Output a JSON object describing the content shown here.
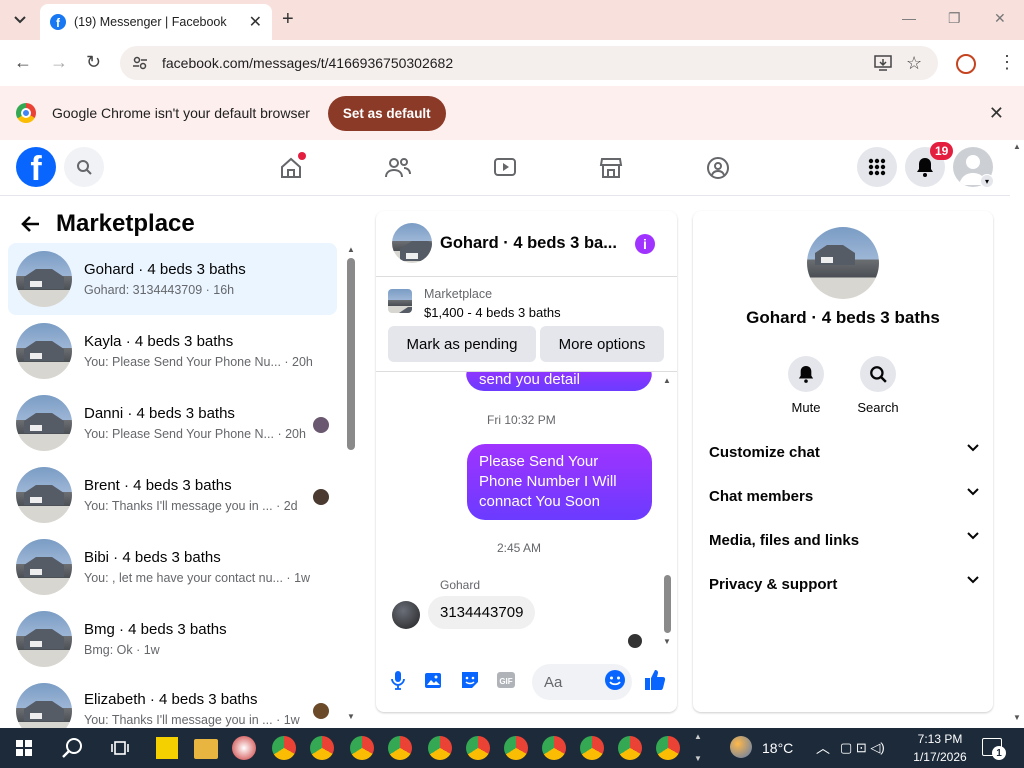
{
  "browser": {
    "tab_title": "(19) Messenger | Facebook",
    "url": "facebook.com/messages/t/4166936750302682",
    "infobar_message": "Google Chrome isn't your default browser",
    "set_default_label": "Set as default"
  },
  "fb": {
    "notification_count": "19"
  },
  "sidebar": {
    "title": "Marketplace",
    "conversations": [
      {
        "name": "Gohard · 4 beds 3 baths",
        "preview": "Gohard: 3134443709 · 16h",
        "active": true
      },
      {
        "name": "Kayla · 4 beds 3 baths",
        "preview": "You: Please Send Your Phone Nu... · 20h"
      },
      {
        "name": "Danni · 4 beds 3 baths",
        "preview": "You: Please Send Your Phone N... · 20h"
      },
      {
        "name": "Brent · 4 beds 3 baths",
        "preview": "You: Thanks I'll message you in ... · 2d"
      },
      {
        "name": "Bibi · 4 beds 3 baths",
        "preview": "You: , let me have your contact nu... · 1w"
      },
      {
        "name": "Bmg · 4 beds 3 baths",
        "preview": "Bmg: Ok · 1w"
      },
      {
        "name": "Elizabeth · 4 beds 3 baths",
        "preview": "You: Thanks I'll message you in ... · 1w"
      }
    ]
  },
  "chat": {
    "title": "Gohard · 4 beds 3 ba...",
    "listing_source": "Marketplace",
    "listing_title": "$1,400 - 4 beds 3 baths",
    "mark_pending_label": "Mark as pending",
    "more_options_label": "More options",
    "partial_message": "send you detail",
    "time1": "Fri 10:32 PM",
    "outgoing_message": "Please Send Your Phone Number I Will connact You Soon",
    "time2": "2:45 AM",
    "sender_name": "Gohard",
    "incoming_message": "3134443709",
    "composer_placeholder": "Aa"
  },
  "details": {
    "title": "Gohard · 4 beds 3 baths",
    "mute_label": "Mute",
    "search_label": "Search",
    "sections": [
      "Customize chat",
      "Chat members",
      "Media, files and links",
      "Privacy & support"
    ]
  },
  "taskbar": {
    "temperature": "18°C",
    "time": "7:13 PM",
    "date": "1/17/2026",
    "notifications": "1"
  }
}
